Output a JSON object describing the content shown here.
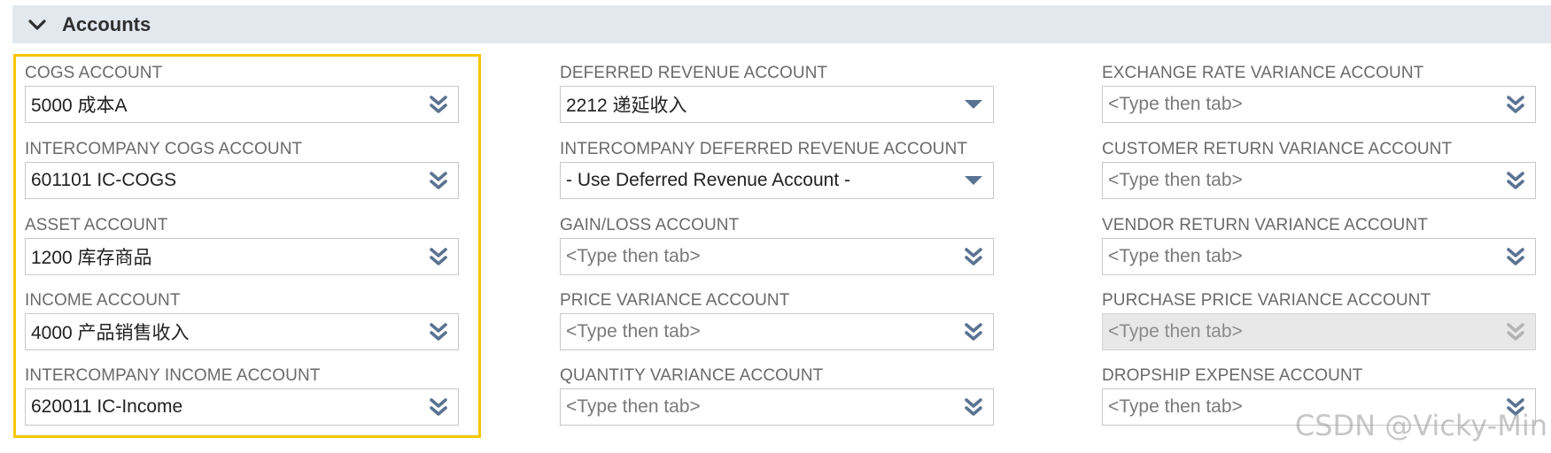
{
  "section": {
    "title": "Accounts",
    "toggle_icon": "chevron-down-icon"
  },
  "colors": {
    "header_bg": "#e3e8ef",
    "highlight": "#f7c600",
    "icon": "#5a7392",
    "disabled_icon": "#b3b3b3"
  },
  "columns": [
    {
      "fields": [
        {
          "id": "cogs",
          "label": "COGS ACCOUNT",
          "value": "5000 成本A",
          "icon": "double-chevron-down-icon"
        },
        {
          "id": "ic-cogs",
          "label": "INTERCOMPANY COGS ACCOUNT",
          "value": "601101 IC-COGS",
          "icon": "double-chevron-down-icon"
        },
        {
          "id": "asset",
          "label": "ASSET ACCOUNT",
          "value": "1200 库存商品",
          "icon": "double-chevron-down-icon"
        },
        {
          "id": "income",
          "label": "INCOME ACCOUNT",
          "value": "4000 产品销售收入",
          "icon": "double-chevron-down-icon"
        },
        {
          "id": "ic-income",
          "label": "INTERCOMPANY INCOME ACCOUNT",
          "value": "620011 IC-Income",
          "icon": "double-chevron-down-icon"
        }
      ]
    },
    {
      "fields": [
        {
          "id": "deferred-revenue",
          "label": "DEFERRED REVENUE ACCOUNT",
          "value": "2212 递延收入",
          "icon": "triangle-down-icon"
        },
        {
          "id": "ic-deferred-revenue",
          "label": "INTERCOMPANY DEFERRED REVENUE ACCOUNT",
          "value": "- Use Deferred Revenue Account -",
          "icon": "triangle-down-icon"
        },
        {
          "id": "gain-loss",
          "label": "GAIN/LOSS ACCOUNT",
          "placeholder": "<Type then tab>",
          "icon": "double-chevron-down-icon"
        },
        {
          "id": "price-variance",
          "label": "PRICE VARIANCE ACCOUNT",
          "placeholder": "<Type then tab>",
          "icon": "double-chevron-down-icon"
        },
        {
          "id": "quantity-variance",
          "label": "QUANTITY VARIANCE ACCOUNT",
          "placeholder": "<Type then tab>",
          "icon": "double-chevron-down-icon"
        }
      ]
    },
    {
      "fields": [
        {
          "id": "exchange-rate-variance",
          "label": "EXCHANGE RATE VARIANCE ACCOUNT",
          "placeholder": "<Type then tab>",
          "icon": "double-chevron-down-icon"
        },
        {
          "id": "customer-return-variance",
          "label": "CUSTOMER RETURN VARIANCE ACCOUNT",
          "placeholder": "<Type then tab>",
          "icon": "double-chevron-down-icon"
        },
        {
          "id": "vendor-return-variance",
          "label": "VENDOR RETURN VARIANCE ACCOUNT",
          "placeholder": "<Type then tab>",
          "icon": "double-chevron-down-icon"
        },
        {
          "id": "purchase-price-variance",
          "label": "PURCHASE PRICE VARIANCE ACCOUNT",
          "placeholder": "<Type then tab>",
          "icon": "double-chevron-down-icon",
          "disabled": true
        },
        {
          "id": "dropship-expense",
          "label": "DROPSHIP EXPENSE ACCOUNT",
          "placeholder": "<Type then tab>",
          "icon": "double-chevron-down-icon"
        }
      ]
    }
  ],
  "watermark": "CSDN @Vicky-Min"
}
